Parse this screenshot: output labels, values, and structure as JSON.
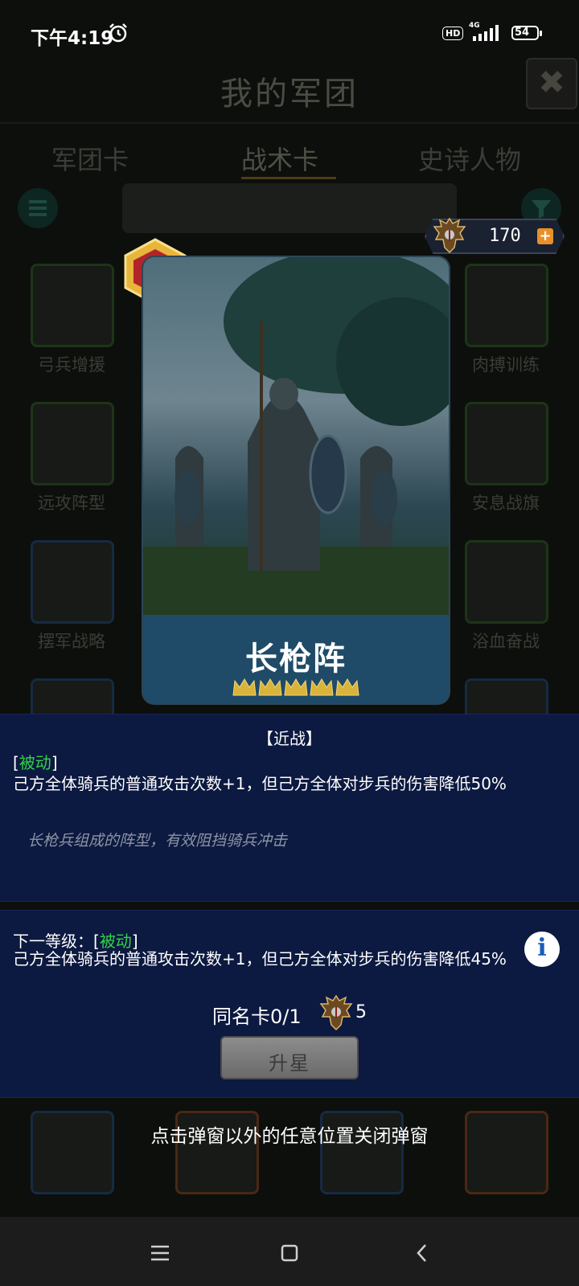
{
  "status_bar": {
    "time": "下午4:19",
    "hd_label": "HD",
    "network": "4G",
    "battery": "54"
  },
  "background": {
    "title": "我的军团",
    "tabs": [
      {
        "label": "军团卡"
      },
      {
        "label": "战术卡",
        "active": true
      },
      {
        "label": "史诗人物"
      }
    ],
    "cards_left": [
      {
        "label": "弓兵增援"
      },
      {
        "label": "远攻阵型"
      },
      {
        "label": "摆军战略"
      }
    ],
    "cards_right": [
      {
        "label": "肉搏训练"
      },
      {
        "label": "安息战旗"
      },
      {
        "label": "浴血奋战"
      }
    ]
  },
  "currency": {
    "amount": "170",
    "plus": "+"
  },
  "card": {
    "name": "长枪阵",
    "stars": 5
  },
  "effect": {
    "category": "【近战】",
    "tag_open": "[",
    "tag": "被动",
    "tag_close": "]",
    "description": "己方全体骑兵的普通攻击次数+1，但己方全体对步兵的伤害降低50%",
    "flavor": "长枪兵组成的阵型，有效阻挡骑兵冲击"
  },
  "next_level": {
    "prefix": "下一等级：[",
    "tag": "被动",
    "tag_close": "]",
    "description": "己方全体骑兵的普通攻击次数+1，但己方全体对步兵的伤害降低45%",
    "info_icon": "i"
  },
  "duplicate": {
    "label": "同名卡0/1",
    "count": "5"
  },
  "upgrade_button": "升星",
  "hint": "点击弹窗以外的任意位置关闭弹窗",
  "colors": {
    "panel": "#0c1940",
    "passive_tag": "#33d24a",
    "name_bar": "#1f4b68",
    "plus_button": "#e8902a",
    "info_icon": "#1a5bb8"
  }
}
